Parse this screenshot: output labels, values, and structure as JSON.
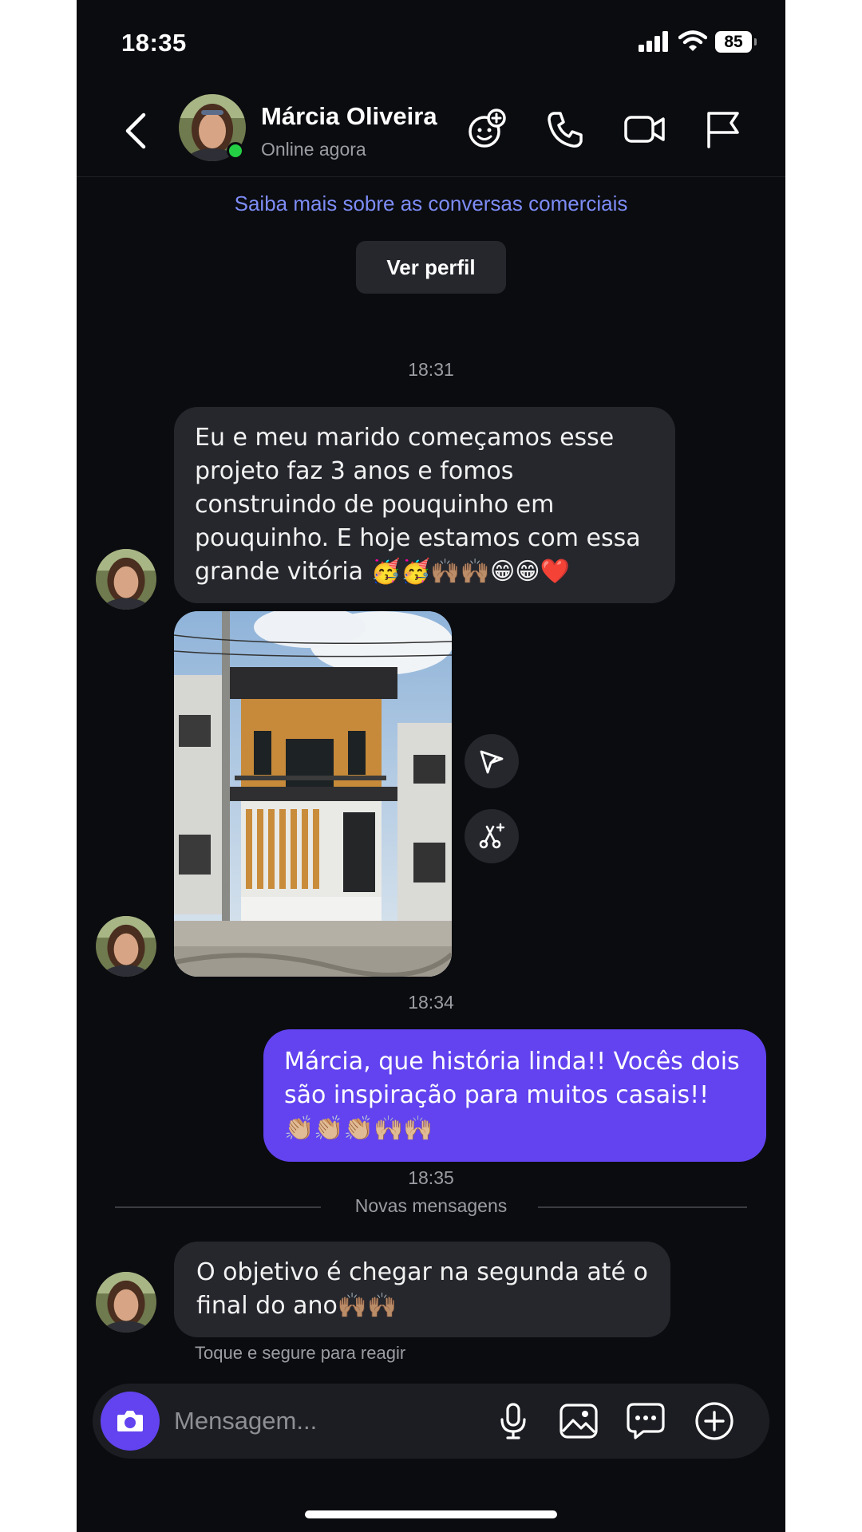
{
  "status_bar": {
    "time": "18:35",
    "battery": "85"
  },
  "header": {
    "name": "Márcia Oliveira",
    "status": "Online agora"
  },
  "business_link": "Saiba mais sobre as conversas comerciais",
  "view_profile_label": "Ver perfil",
  "timestamps": {
    "t1": "18:31",
    "t2": "18:34",
    "t3": "18:35"
  },
  "messages": [
    {
      "from": "contact",
      "text": "Eu e meu marido começamos esse projeto faz 3 anos e fomos construindo de pouquinho em pouquinho. E hoje estamos com essa grande vitória 🥳🥳🙌🏽🙌🏽😁😁❤️"
    },
    {
      "from": "me",
      "text": "Márcia, que história linda!! Vocês dois são inspiração para muitos casais!! 👏🏼👏🏼👏🏼🙌🏼🙌🏼"
    },
    {
      "from": "contact",
      "text": "O objetivo é chegar na segunda até o final do ano🙌🏽🙌🏽"
    }
  ],
  "divider_label": "Novas mensagens",
  "reaction_hint": "Toque e segure para reagir",
  "composer": {
    "placeholder": "Mensagem..."
  },
  "colors": {
    "background": "#0b0c10",
    "incoming_bubble": "#25272d",
    "outgoing_bubble": "#6243ef",
    "link": "#7d8cf6",
    "online": "#25d144"
  },
  "icons": [
    "back-chevron-icon",
    "add-friend-icon",
    "phone-icon",
    "video-call-icon",
    "flag-icon",
    "send-icon",
    "remix-icon",
    "camera-icon",
    "microphone-icon",
    "gallery-icon",
    "chat-bubble-icon",
    "plus-circle-icon"
  ]
}
